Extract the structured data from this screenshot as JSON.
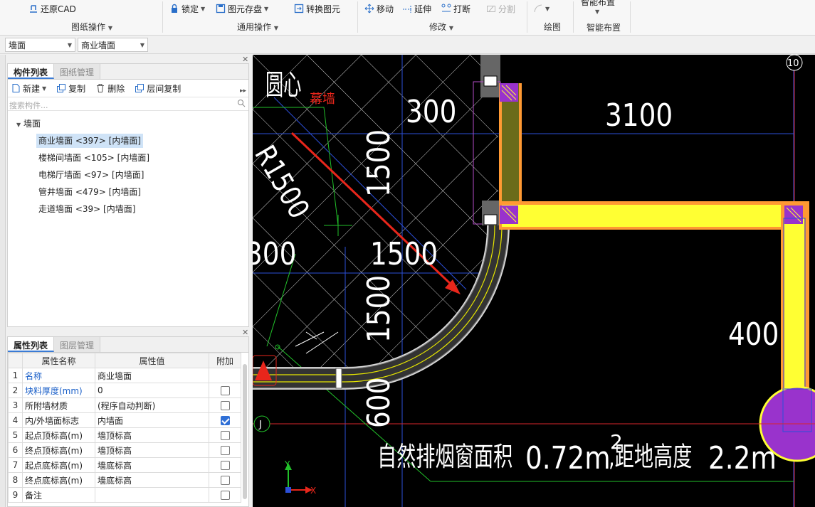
{
  "ribbon": {
    "restore_cad": "还原CAD",
    "drawing_ops_group": "图纸操作",
    "lock": "锁定",
    "save_element": "图元存盘",
    "convert_element": "转换图元",
    "common_ops_group": "通用操作",
    "move": "移动",
    "extend": "延伸",
    "break": "打断",
    "split": "分割",
    "modify_group": "修改",
    "draw_group": "绘图",
    "smart_layout_button": "智能布置",
    "smart_layout_group": "智能布置"
  },
  "filters": {
    "category": "墙面",
    "item": "商业墙面"
  },
  "component_panel": {
    "tabs": [
      "构件列表",
      "图纸管理"
    ],
    "toolbar": {
      "new": "新建",
      "copy": "复制",
      "delete": "删除",
      "floor_copy": "层间复制"
    },
    "search_placeholder": "搜索构件...",
    "tree_root": "墙面",
    "items": [
      "商业墙面 <397> [内墙面]",
      "楼梯间墙面 <105> [内墙面]",
      "电梯厅墙面 <97> [内墙面]",
      "管井墙面 <479> [内墙面]",
      "走道墙面 <39> [内墙面]"
    ]
  },
  "property_panel": {
    "tabs": [
      "属性列表",
      "图层管理"
    ],
    "headers": [
      "属性名称",
      "属性值",
      "附加"
    ],
    "rows": [
      {
        "no": "1",
        "name": "名称",
        "value": "商业墙面",
        "blue": true,
        "checkbox": "none"
      },
      {
        "no": "2",
        "name": "块料厚度(mm)",
        "value": "0",
        "blue": true,
        "checkbox": "off"
      },
      {
        "no": "3",
        "name": "所附墙材质",
        "value": "(程序自动判断)",
        "blue": false,
        "checkbox": "off"
      },
      {
        "no": "4",
        "name": "内/外墙面标志",
        "value": "内墙面",
        "blue": false,
        "checkbox": "on"
      },
      {
        "no": "5",
        "name": "起点顶标高(m)",
        "value": "墙顶标高",
        "blue": false,
        "checkbox": "off"
      },
      {
        "no": "6",
        "name": "终点顶标高(m)",
        "value": "墙顶标高",
        "blue": false,
        "checkbox": "off"
      },
      {
        "no": "7",
        "name": "起点底标高(m)",
        "value": "墙底标高",
        "blue": false,
        "checkbox": "off"
      },
      {
        "no": "8",
        "name": "终点底标高(m)",
        "value": "墙底标高",
        "blue": false,
        "checkbox": "off"
      },
      {
        "no": "9",
        "name": "备注",
        "value": "",
        "blue": false,
        "checkbox": "off"
      }
    ]
  },
  "cad": {
    "dim_300_top": "300",
    "dim_3100": "3100",
    "dim_1500_vert_top": "1500",
    "dim_1500_center": "1500",
    "dim_300_left": "300",
    "dim_1500_vert_bottom": "1500",
    "dim_400": "400",
    "dim_600": "600",
    "radius_label": "R1500",
    "center_label": "圆心",
    "curtain_wall_label": "幕墙",
    "axis_10": "10",
    "axis_j": "J",
    "note_text": "自然排烟窗面积",
    "note_area": "0.72m",
    "note_sup": "2",
    "note_height": ",距地高度",
    "note_height_value": "2.2m",
    "axis_x": "X",
    "axis_y": "Y",
    "colors": {
      "wall_fill": "#ffff33",
      "wall_border": "#ff9933",
      "column": "#9933cc",
      "arrow": "#e8261b",
      "grid": "#cccccc",
      "dim": "#2b4fd8"
    }
  }
}
